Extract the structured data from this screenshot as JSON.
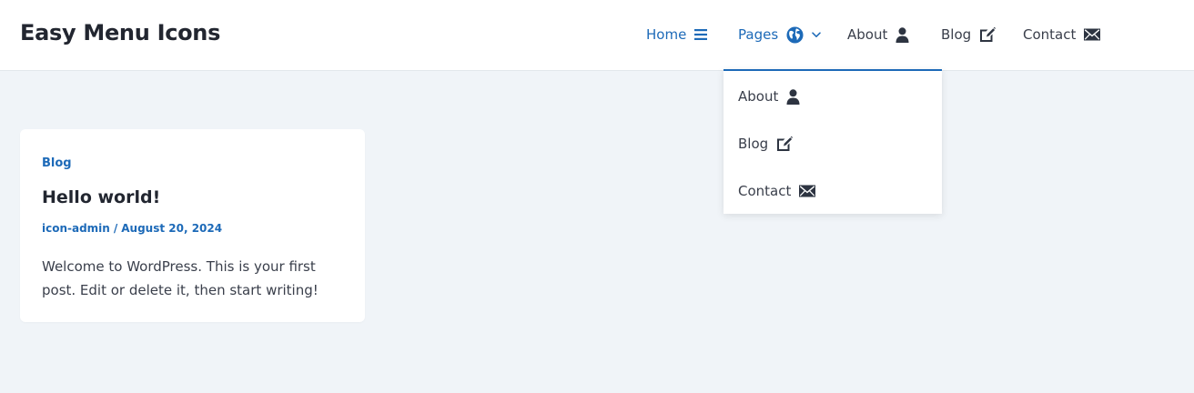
{
  "site": {
    "title": "Easy Menu Icons"
  },
  "nav": {
    "items": [
      {
        "label": "Home",
        "icon": "hamburger-icon"
      },
      {
        "label": "Pages",
        "icon": "globe-icon",
        "submenu_icon": "chevron-down-icon"
      },
      {
        "label": "About",
        "icon": "user-icon"
      },
      {
        "label": "Blog",
        "icon": "edit-icon"
      },
      {
        "label": "Contact",
        "icon": "envelope-icon"
      }
    ],
    "dropdown": [
      {
        "label": "About",
        "icon": "user-icon"
      },
      {
        "label": "Blog",
        "icon": "edit-icon"
      },
      {
        "label": "Contact",
        "icon": "envelope-icon"
      }
    ]
  },
  "post": {
    "category": "Blog",
    "title": "Hello world!",
    "author": "icon-admin",
    "separator": "/",
    "date": "August 20, 2024",
    "excerpt": "Welcome to WordPress. This is your first post. Edit or delete it, then start writing!"
  },
  "colors": {
    "accent": "#1d6ab8",
    "text": "#3a3f4b",
    "heading": "#222630",
    "background": "#f0f4f8",
    "surface": "#ffffff"
  }
}
